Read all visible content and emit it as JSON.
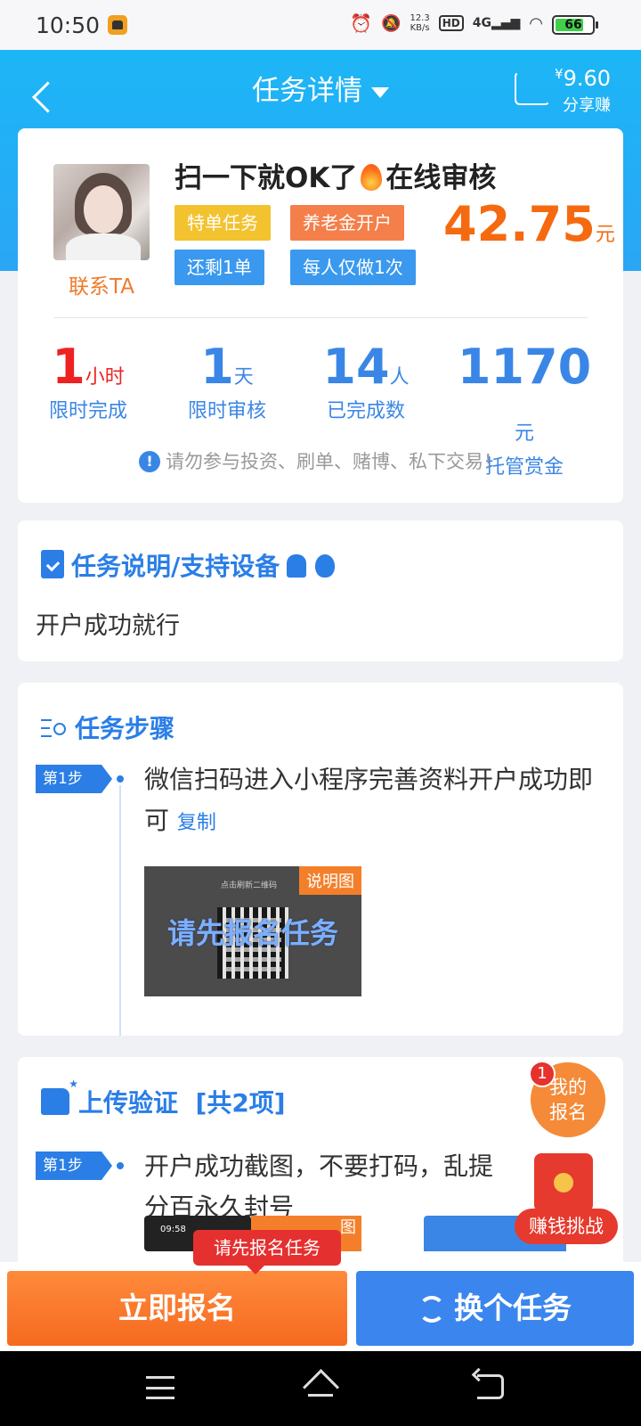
{
  "status_bar": {
    "time": "10:50",
    "net_speed": "12.3",
    "net_unit": "KB/s",
    "hd": "HD",
    "signal": "4G",
    "battery": "66"
  },
  "header": {
    "title": "任务详情",
    "share_currency": "¥",
    "share_amount": "9.60",
    "share_label": "分享赚"
  },
  "task": {
    "contact_label": "联系TA",
    "title_part1": "扫一下就OK了",
    "title_part2": "在线审核",
    "tags": [
      "特单任务",
      "养老金开户",
      "还剩1单",
      "每人仅做1次"
    ],
    "price": "42.75",
    "price_unit": "元",
    "stats": [
      {
        "value": "1",
        "unit": "小时",
        "label": "限时完成"
      },
      {
        "value": "1",
        "unit": "天",
        "label": "限时审核"
      },
      {
        "value": "14",
        "unit": "人",
        "label": "已完成数"
      },
      {
        "value": "1170",
        "unit": "元",
        "label": "托管赏金"
      }
    ],
    "warning_icon": "!",
    "warning": "请勿参与投资、刷单、赌博、私下交易！"
  },
  "description": {
    "title": "任务说明/支持设备",
    "text": "开户成功就行"
  },
  "steps": {
    "title": "任务步骤",
    "step_badge": "第1步",
    "step_text": "微信扫码进入小程序完善资料开户成功即可",
    "copy_label": "复制",
    "image_small_text": "点击刷新二维码",
    "image_overlay": "请先报名任务",
    "image_tag": "说明图"
  },
  "upload": {
    "title": "上传验证",
    "count": "[共2项]",
    "step_badge": "第1步",
    "step_text": "开户成功截图，不要打码，乱提",
    "step_text2": "分百永久封号",
    "thumb_time": "09:58",
    "thumb_tag": "图"
  },
  "floating": {
    "my_badge": "1",
    "my_label_line1": "我的",
    "my_label_line2": "报名",
    "challenge_label": "赚钱挑战"
  },
  "tooltip": "请先报名任务",
  "bottom": {
    "signup": "立即报名",
    "switch": "换个任务"
  }
}
